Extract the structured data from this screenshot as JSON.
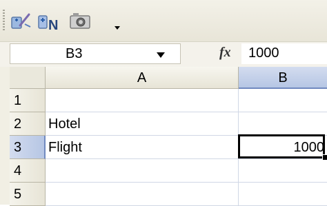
{
  "toolbar": {
    "buttons": [
      {
        "name": "insert-hyperlink-icon"
      },
      {
        "name": "insert-name-icon"
      },
      {
        "name": "camera-icon"
      },
      {
        "name": "toolbar-options-dropdown-icon"
      }
    ]
  },
  "formula_bar": {
    "name_box": "B3",
    "fx_label": "fx",
    "formula": "1000"
  },
  "sheet": {
    "columns": [
      "A",
      "B"
    ],
    "rows": [
      {
        "header": "1",
        "A": "",
        "B": ""
      },
      {
        "header": "2",
        "A": "Hotel",
        "B": ""
      },
      {
        "header": "3",
        "A": "Flight",
        "B": "1000"
      },
      {
        "header": "4",
        "A": "",
        "B": ""
      },
      {
        "header": "5",
        "A": "",
        "B": ""
      }
    ],
    "active_cell": "B3"
  },
  "colors": {
    "toolbar_bg": "#ece9d8",
    "selected_header": "#c2cfe9",
    "gridline": "#d0d7e5"
  }
}
